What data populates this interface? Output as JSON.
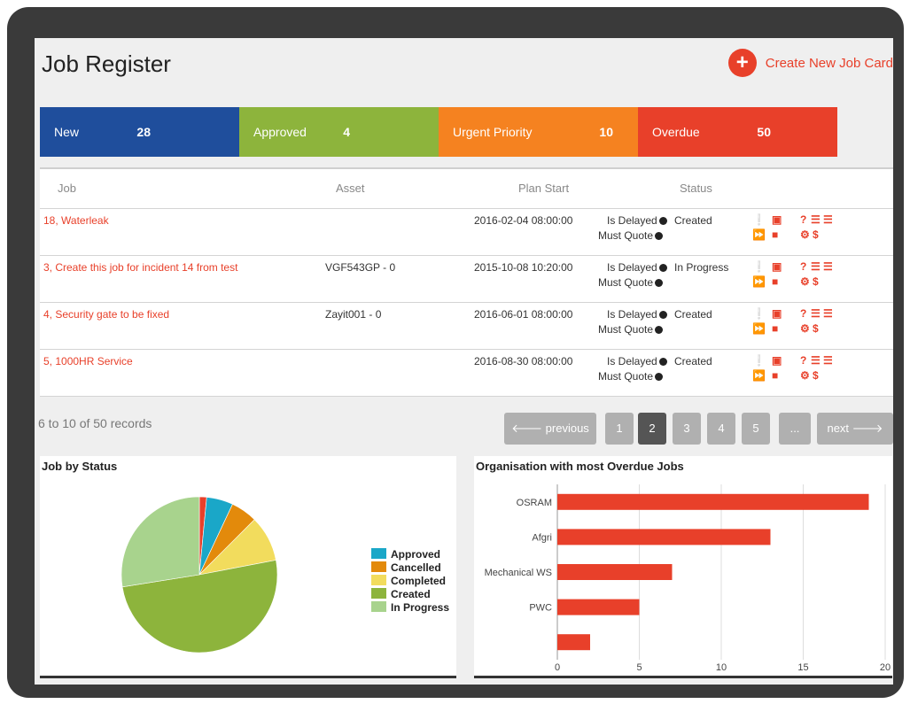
{
  "header": {
    "title": "Job Register",
    "create_label": "Create New Job Card",
    "plus": "+"
  },
  "summary": [
    {
      "label": "New",
      "count": "28",
      "color": "#1f4e9c"
    },
    {
      "label": "Approved",
      "count": "4",
      "color": "#8db43c"
    },
    {
      "label": "Urgent Priority",
      "count": "10",
      "color": "#f58220"
    },
    {
      "label": "Overdue",
      "count": "50",
      "color": "#e8402a"
    }
  ],
  "table": {
    "headers": {
      "job": "Job",
      "asset": "Asset",
      "plan_start": "Plan Start",
      "status": "Status"
    },
    "rows": [
      {
        "job": "18, Waterleak",
        "asset": "",
        "plan_start": "2016-02-04 08:00:00",
        "delayed": "Is Delayed",
        "quote": "Must Quote",
        "status": "Created"
      },
      {
        "job": "3, Create this job for incident 14 from test",
        "asset": "VGF543GP - 0",
        "plan_start": "2015-10-08 10:20:00",
        "delayed": "Is Delayed",
        "quote": "Must Quote",
        "status": "In Progress"
      },
      {
        "job": "4, Security gate to be fixed",
        "asset": "Zayit001 - 0",
        "plan_start": "2016-06-01 08:00:00",
        "delayed": "Is Delayed",
        "quote": "Must Quote",
        "status": "Created"
      },
      {
        "job": "5, 1000HR Service",
        "asset": "",
        "plan_start": "2016-08-30 08:00:00",
        "delayed": "Is Delayed",
        "quote": "Must Quote",
        "status": "Created"
      }
    ]
  },
  "pagination": {
    "records": "6 to 10 of 50 records",
    "previous": "🡐 previous",
    "pages": [
      "1",
      "2",
      "3",
      "4",
      "5",
      "..."
    ],
    "active_page": "2",
    "next": "next 🡒"
  },
  "pie_panel": {
    "title": "Job by Status",
    "chart_data": {
      "type": "pie",
      "slices": [
        {
          "label": "",
          "value": 1.5,
          "color": "#e8402a"
        },
        {
          "label": "Approved",
          "value": 5.5,
          "color": "#1aa7c8"
        },
        {
          "label": "Cancelled",
          "value": 5.5,
          "color": "#e38a0b"
        },
        {
          "label": "Completed",
          "value": 9.5,
          "color": "#f2dc5d"
        },
        {
          "label": "Created",
          "value": 50.5,
          "color": "#8db43c"
        },
        {
          "label": "In Progress",
          "value": 27.5,
          "color": "#a8d38d"
        }
      ],
      "legend": [
        "Approved",
        "Cancelled",
        "Completed",
        "Created",
        "In Progress"
      ],
      "legend_position": "right"
    }
  },
  "bar_panel": {
    "title": "Organisation with most Overdue Jobs",
    "chart_data": {
      "type": "bar",
      "orientation": "horizontal",
      "categories": [
        "OSRAM",
        "Afgri",
        "Mechanical WS",
        "PWC",
        ""
      ],
      "values": [
        19,
        13,
        7,
        5,
        2
      ],
      "xlim": [
        0,
        20
      ],
      "xticks": [
        "0",
        "5",
        "10",
        "15",
        "20"
      ],
      "color": "#e8402a",
      "grid": true
    }
  }
}
